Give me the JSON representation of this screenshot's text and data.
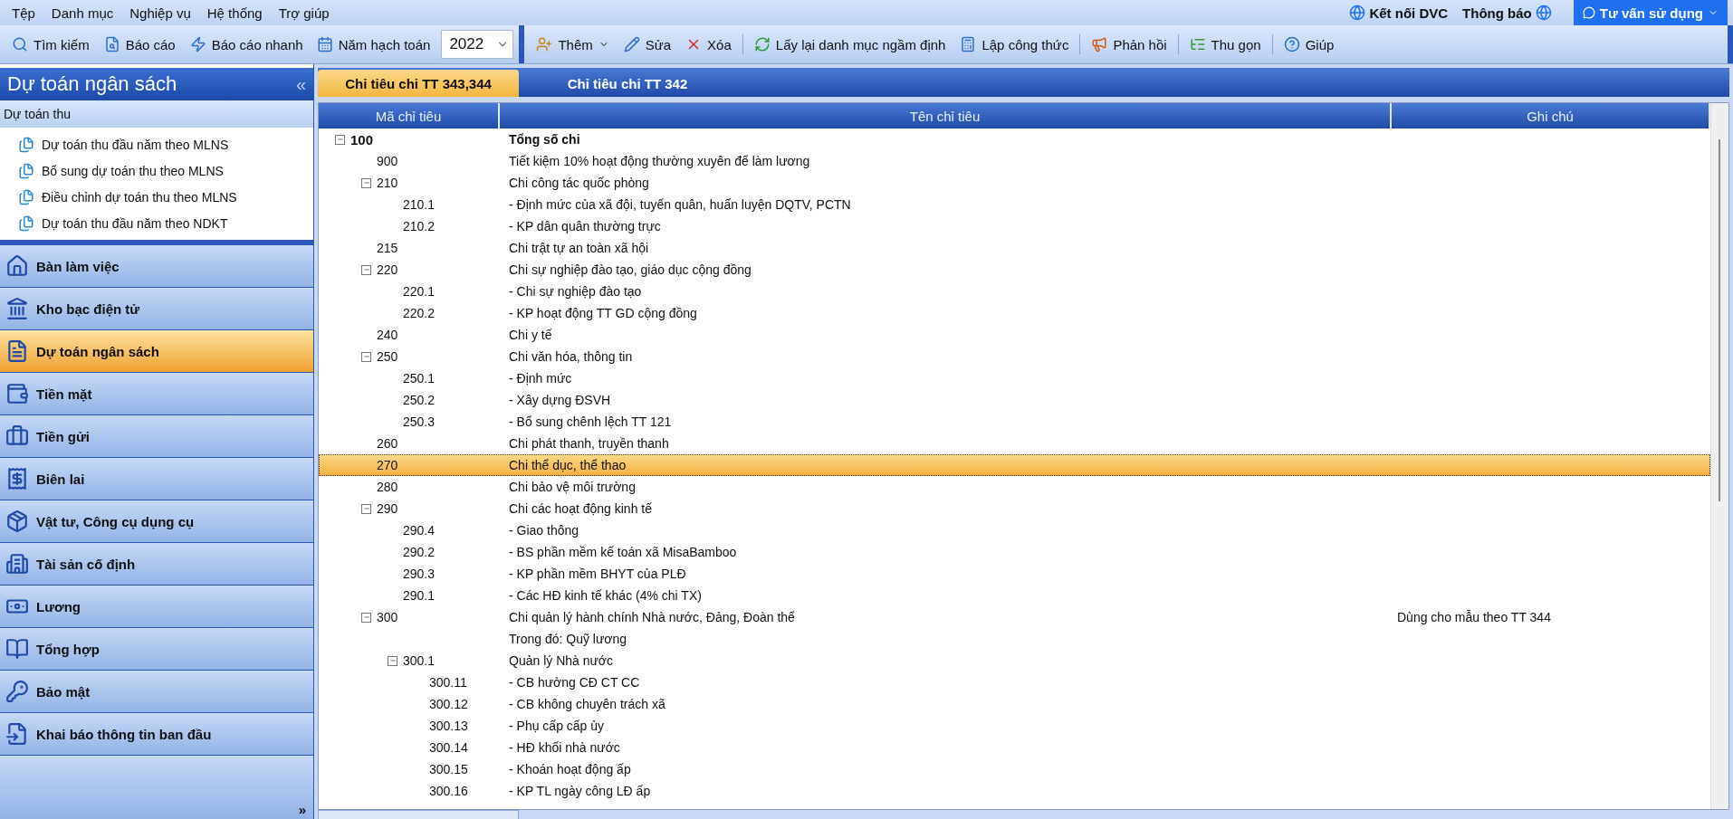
{
  "menu": [
    "Tệp",
    "Danh mục",
    "Nghiệp vụ",
    "Hệ thống",
    "Trợ giúp"
  ],
  "top_links": [
    {
      "label": "Kết nối DVC",
      "kind": "globe"
    },
    {
      "label": "Thông báo",
      "kind": "globe"
    }
  ],
  "advisor_button": {
    "label": "Tư vấn sử dụng"
  },
  "toolbar_left": [
    {
      "label": "Tìm kiếm"
    },
    {
      "label": "Báo cáo"
    },
    {
      "label": "Báo cáo nhanh"
    },
    {
      "label": "Năm hạch toán"
    }
  ],
  "year_select": {
    "value": "2022"
  },
  "toolbar_right": [
    {
      "label": "Thêm",
      "dropdown": true
    },
    {
      "label": "Sửa",
      "dropdown": false
    },
    {
      "label": "Xóa",
      "dropdown": false
    },
    {
      "label": "Lấy lại danh mục ngầm định",
      "dropdown": false
    },
    {
      "label": "Lập công thức",
      "dropdown": false
    },
    {
      "label": "Phản hồi",
      "dropdown": false
    },
    {
      "label": "Thu gọn",
      "dropdown": false
    },
    {
      "label": "Giúp",
      "dropdown": false
    }
  ],
  "sidebar": {
    "title": "Dự toán ngân sách",
    "collapse": "«",
    "group": "Dự toán thu",
    "tasks": [
      "Dự toán thu đầu năm theo MLNS",
      "Bổ sung dự toán thu theo MLNS",
      "Điều chỉnh dự toán thu theo MLNS",
      "Dự toán thu đầu năm theo NDKT"
    ],
    "nav": [
      {
        "label": "Bàn làm việc",
        "selected": false
      },
      {
        "label": "Kho bạc điện tử",
        "selected": false
      },
      {
        "label": "Dự toán ngân sách",
        "selected": true
      },
      {
        "label": "Tiền mặt",
        "selected": false
      },
      {
        "label": "Tiền gửi",
        "selected": false
      },
      {
        "label": "Biên lai",
        "selected": false
      },
      {
        "label": "Vật tư, Công cụ dụng cụ",
        "selected": false
      },
      {
        "label": "Tài sản cố định",
        "selected": false
      },
      {
        "label": "Lương",
        "selected": false
      },
      {
        "label": "Tổng hợp",
        "selected": false
      },
      {
        "label": "Bảo mật",
        "selected": false
      },
      {
        "label": "Khai báo thông tin ban đầu",
        "selected": false
      }
    ],
    "more": "»"
  },
  "tabs": [
    {
      "label": "Chỉ tiêu chi TT 343,344",
      "selected": true
    },
    {
      "label": "Chỉ tiêu chi TT 342",
      "selected": false
    }
  ],
  "table": {
    "columns": [
      "Mã chỉ tiêu",
      "Tên chỉ tiêu",
      "Ghi chú"
    ],
    "rows": [
      {
        "code": "100",
        "name": "Tổng số chi",
        "bold": true,
        "selected": false,
        "expanded": true,
        "children": [
          {
            "code": "900",
            "name": "Tiết kiệm 10% hoạt động thường xuyên để làm lương",
            "selected": false
          },
          {
            "code": "210",
            "name": "Chi công tác quốc phòng",
            "selected": false,
            "expanded": true,
            "children": [
              {
                "code": "210.1",
                "name": "- Định mức của xã đội, tuyển quân, huấn luyện DQTV,  PCTN",
                "selected": false
              },
              {
                "code": "210.2",
                "name": "- KP dân quân thường trực",
                "selected": false
              }
            ]
          },
          {
            "code": "215",
            "name": "Chi trật tự an toàn xã hội",
            "selected": false
          },
          {
            "code": "220",
            "name": "Chi sự nghiệp đào tạo, giáo dục cộng đồng",
            "selected": false,
            "expanded": true,
            "children": [
              {
                "code": "220.1",
                "name": "- Chi sự nghiệp đào tạo",
                "selected": false
              },
              {
                "code": "220.2",
                "name": "- KP hoạt động TT GD cộng đồng",
                "selected": false
              }
            ]
          },
          {
            "code": "240",
            "name": "Chi y tế",
            "selected": false
          },
          {
            "code": "250",
            "name": "Chi văn hóa, thông tin",
            "selected": false,
            "expanded": true,
            "children": [
              {
                "code": "250.1",
                "name": "- Định mức",
                "selected": false
              },
              {
                "code": "250.2",
                "name": "- Xây dựng ĐSVH",
                "selected": false
              },
              {
                "code": "250.3",
                "name": "- Bổ sung chênh lệch TT 121",
                "selected": false
              }
            ]
          },
          {
            "code": "260",
            "name": "Chi phát thanh, truyền thanh",
            "selected": false
          },
          {
            "code": "270",
            "name": "Chi thể dục, thể thao",
            "selected": true
          },
          {
            "code": "280",
            "name": "Chi bảo vệ môi trường",
            "selected": false
          },
          {
            "code": "290",
            "name": "Chi các hoạt động kinh tế",
            "selected": false,
            "expanded": true,
            "children": [
              {
                "code": "290.4",
                "name": "- Giao thông",
                "selected": false
              },
              {
                "code": "290.2",
                "name": "- BS phần mềm kế toán xã MisaBamboo",
                "selected": false
              },
              {
                "code": "290.3",
                "name": "- KP phần mềm BHYT của PLĐ",
                "selected": false
              },
              {
                "code": "290.1",
                "name": "- Các HĐ kinh tế khác (4% chi TX)",
                "selected": false
              }
            ]
          },
          {
            "code": "300",
            "name": "Chi quản lý hành chính Nhà nước, Đảng, Đoàn thể",
            "note": "Dùng cho mẫu theo TT 344",
            "selected": false,
            "expanded": true,
            "children": [
              {
                "name": "Trong đó: Quỹ lương",
                "selected": false
              },
              {
                "code": "300.1",
                "name": "Quản lý Nhà nước",
                "selected": false,
                "expanded": true,
                "children": [
                  {
                    "code": "300.11",
                    "name": "- CB hưởng CĐ CT CC",
                    "selected": false
                  },
                  {
                    "code": "300.12",
                    "name": "- CB không chuyên trách xã",
                    "selected": false
                  },
                  {
                    "code": "300.13",
                    "name": "- Phụ cấp cấp ủy",
                    "selected": false
                  },
                  {
                    "code": "300.14",
                    "name": "- HĐ khối nhà nước",
                    "selected": false
                  },
                  {
                    "code": "300.15",
                    "name": "- Khoán hoạt động ấp",
                    "selected": false
                  },
                  {
                    "code": "300.16",
                    "name": "- KP TL ngày công LĐ ấp",
                    "selected": false
                  }
                ]
              }
            ]
          }
        ]
      }
    ]
  }
}
